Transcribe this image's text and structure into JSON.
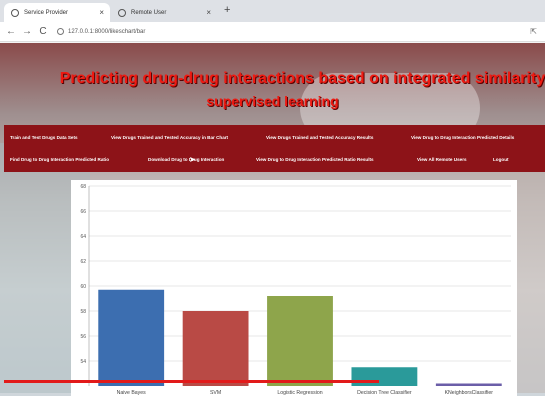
{
  "browser": {
    "tabs": [
      {
        "label": "Service Provider",
        "active": true
      },
      {
        "label": "Remote User",
        "active": false
      }
    ],
    "new_tab": "+",
    "close": "×",
    "url": "127.0.0.1:8000/likeschart/bar",
    "nav": {
      "back": "←",
      "forward": "→",
      "reload": "C"
    }
  },
  "page": {
    "title_line1": "Predicting drug-drug interactions based on integrated similarity and se",
    "title_line2": "supervised learning",
    "menu_row1": [
      "Train and Test Drugs Data Sets",
      "View Drugs Trained and Tested Accuracy in Bar Chart",
      "View Drugs Trained and Tested Accuracy Results",
      "View Drug to Drug Interaction Predicted Details"
    ],
    "menu_row2": [
      "Find Drug to Drug Interaction Predicted Ratio",
      "Download Drug to Drug Interaction",
      "View Drug to Drug Interaction Predicted Ratio Results",
      "View All Remote Users",
      "Logout"
    ]
  },
  "chart_data": {
    "type": "bar",
    "categories": [
      "Naive Bayes",
      "SVM",
      "Logistic Regression",
      "Decision Tree Classifier",
      "KNeighborsClassifier"
    ],
    "values": [
      59.7,
      58.0,
      59.2,
      53.5,
      52.2
    ],
    "ylim": [
      52,
      68
    ],
    "yticks": [
      54,
      56,
      58,
      60,
      62,
      64,
      66,
      68
    ],
    "colors": [
      "#3c6eb0",
      "#b94a45",
      "#8ea54b",
      "#2a9a9a",
      "#6b5ea8"
    ],
    "grid": true
  }
}
